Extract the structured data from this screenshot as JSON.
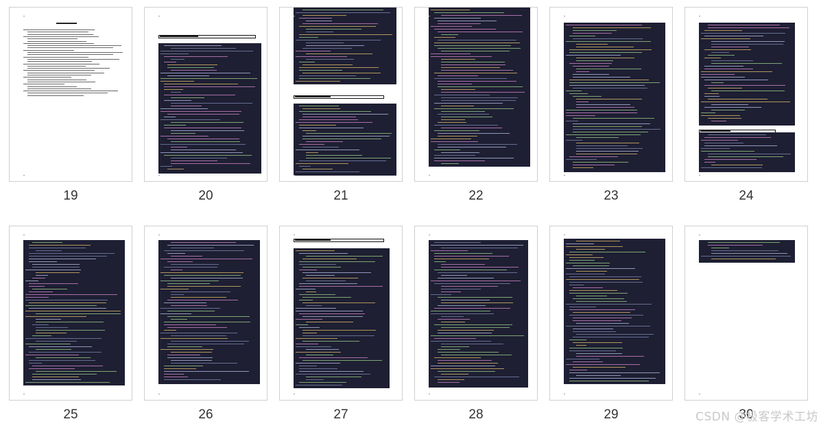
{
  "viewer": {
    "pages": [
      {
        "number": "19"
      },
      {
        "number": "20"
      },
      {
        "number": "21"
      },
      {
        "number": "22"
      },
      {
        "number": "23"
      },
      {
        "number": "24"
      },
      {
        "number": "25"
      },
      {
        "number": "26"
      },
      {
        "number": "27"
      },
      {
        "number": "28"
      },
      {
        "number": "29"
      },
      {
        "number": "30"
      }
    ]
  },
  "watermark": {
    "text": "CSDN @极客学术工坊"
  },
  "colors": {
    "code_bg": "#1e1f33",
    "code_text": "#b9c2e8",
    "code_accent": "#e3c06b",
    "code_comment": "#7f8ab3"
  }
}
